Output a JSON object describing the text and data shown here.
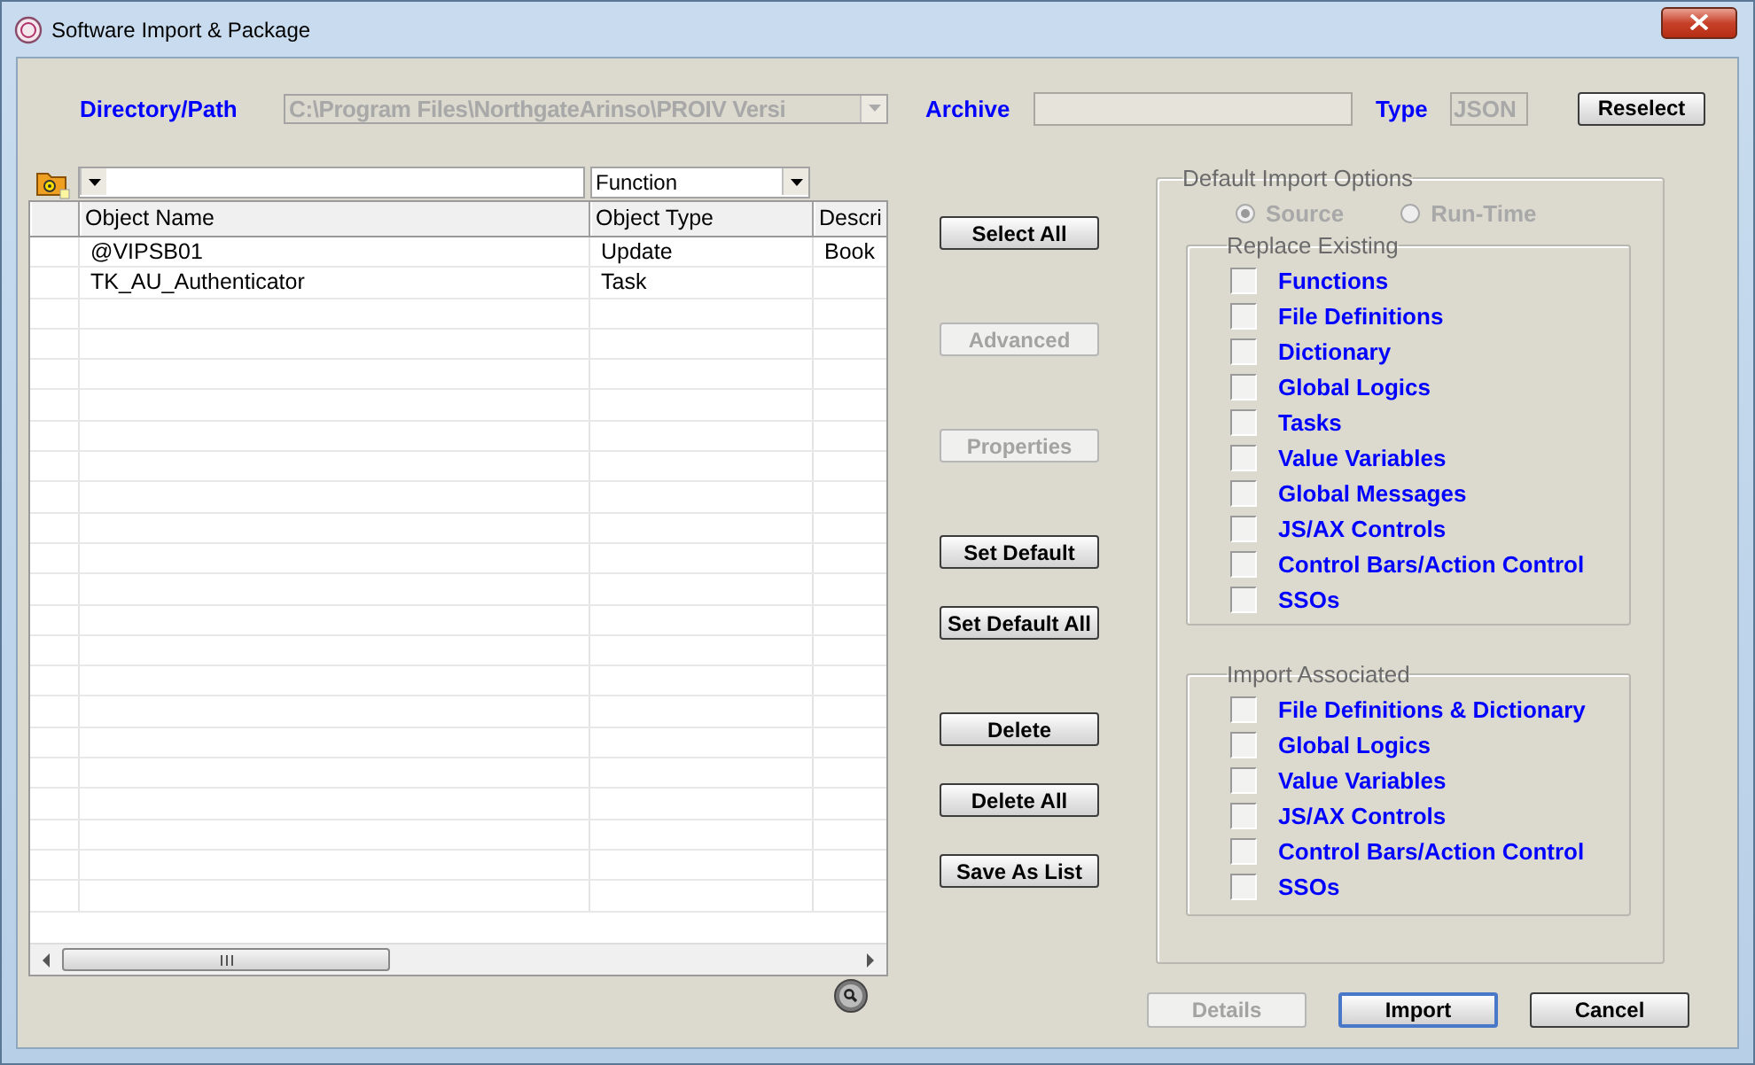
{
  "window": {
    "title": "Software Import & Package"
  },
  "source": {
    "directory_label": "Directory/Path",
    "directory_value": "C:\\Program Files\\NorthgateArinso\\PROIV Versi",
    "directory_disabled": true,
    "archive_label": "Archive",
    "type_label": "Type",
    "type_value": "JSON",
    "type_disabled": true
  },
  "reselect_button": {
    "label": "Reselect",
    "disabled": false
  },
  "filter": {
    "type_value": "Function"
  },
  "table": {
    "columns": [
      "Object Name",
      "Object Type",
      "Descri"
    ],
    "rows": [
      {
        "name": "@VIPSB01",
        "type": "Update",
        "description": "Book"
      },
      {
        "name": "TK_AU_Authenticator",
        "type": "Task"
      }
    ]
  },
  "action_buttons": [
    {
      "label": "Select All",
      "disabled": false
    },
    {
      "label": "Advanced",
      "disabled": true
    },
    {
      "label": "Properties",
      "disabled": true
    },
    {
      "label": "Set Default",
      "disabled": false
    },
    {
      "label": "Set Default All",
      "disabled": false
    },
    {
      "label": "Delete",
      "disabled": false
    },
    {
      "label": "Delete All",
      "disabled": false
    },
    {
      "label": "Save As List",
      "disabled": false
    }
  ],
  "options": {
    "title": "Default Import Options",
    "disabled": true,
    "radios": [
      {
        "label": "Source",
        "selected": true
      },
      {
        "label": "Run-Time",
        "selected": false
      }
    ],
    "groups": [
      {
        "title": "Replace Existing",
        "items": [
          {
            "label": "Functions",
            "checked": false
          },
          {
            "label": "File Definitions",
            "checked": false
          },
          {
            "label": "Dictionary",
            "checked": false
          },
          {
            "label": "Global Logics",
            "checked": false
          },
          {
            "label": "Tasks",
            "checked": false
          },
          {
            "label": "Value Variables",
            "checked": false
          },
          {
            "label": "Global Messages",
            "checked": false
          },
          {
            "label": "JS/AX Controls",
            "checked": false
          },
          {
            "label": "Control Bars/Action Control",
            "checked": false
          },
          {
            "label": "SSOs",
            "checked": false
          }
        ]
      },
      {
        "title": "Import Associated",
        "items": [
          {
            "label": "File Definitions & Dictionary",
            "checked": false
          },
          {
            "label": "Global Logics",
            "checked": false
          },
          {
            "label": "Value Variables",
            "checked": false
          },
          {
            "label": "JS/AX Controls",
            "checked": false
          },
          {
            "label": "Control Bars/Action Control",
            "checked": false
          },
          {
            "label": "SSOs",
            "checked": false
          }
        ]
      }
    ]
  },
  "footer_buttons": [
    {
      "label": "Details",
      "disabled": true,
      "default": false
    },
    {
      "label": "Import",
      "disabled": false,
      "default": true
    },
    {
      "label": "Cancel",
      "disabled": false,
      "default": false
    }
  ]
}
